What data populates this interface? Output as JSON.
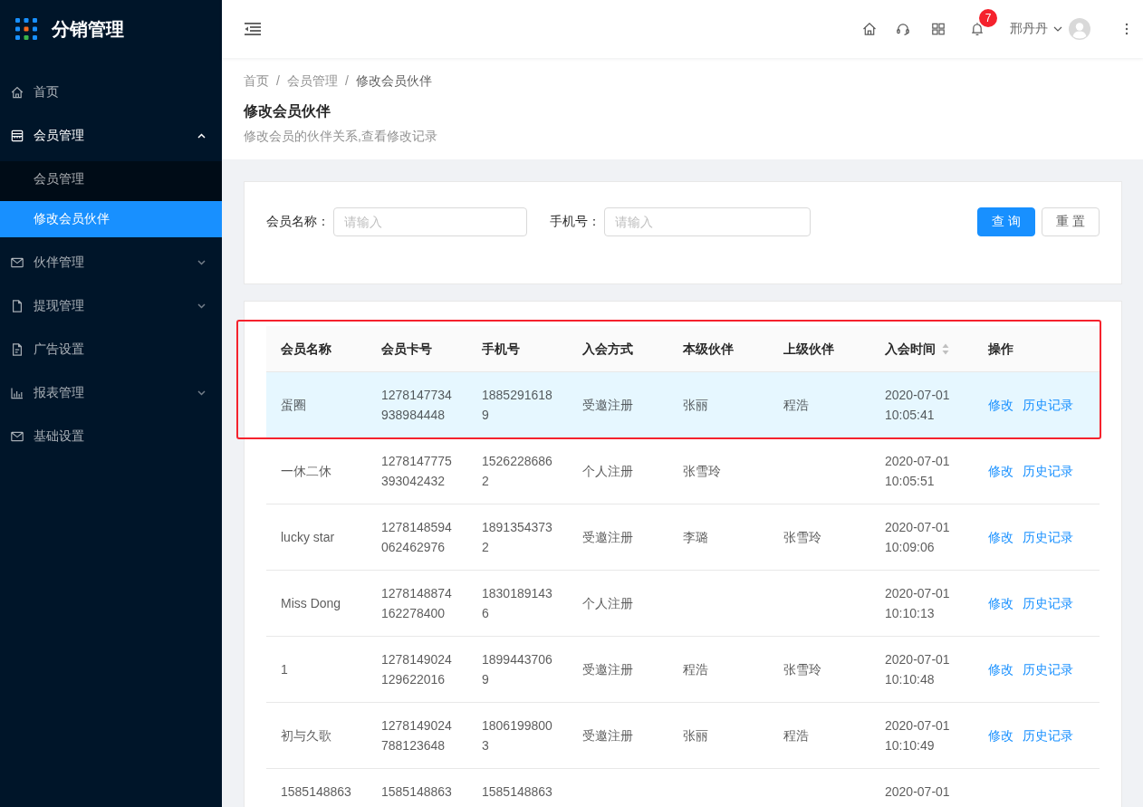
{
  "sidebar": {
    "title": "分销管理",
    "items": [
      {
        "kind": "link",
        "label": "首页",
        "selected": false
      },
      {
        "kind": "submenu",
        "label": "会员管理",
        "expanded": true,
        "children": [
          {
            "label": "会员管理",
            "selected": false
          },
          {
            "label": "修改会员伙伴",
            "selected": true
          }
        ]
      },
      {
        "kind": "submenu",
        "label": "伙伴管理",
        "expanded": false
      },
      {
        "kind": "submenu",
        "label": "提现管理",
        "expanded": false
      },
      {
        "kind": "link",
        "label": "广告设置",
        "selected": false
      },
      {
        "kind": "submenu",
        "label": "报表管理",
        "expanded": false
      },
      {
        "kind": "link",
        "label": "基础设置",
        "selected": false
      }
    ]
  },
  "header": {
    "notification_count": "7",
    "user_name": "邢丹丹"
  },
  "page_header": {
    "breadcrumb": {
      "separator": "/",
      "items": [
        "首页",
        "会员管理",
        "修改会员伙伴"
      ]
    },
    "title": "修改会员伙伴",
    "description": "修改会员的伙伴关系,查看修改记录"
  },
  "search": {
    "fields": [
      {
        "label": "会员名称：",
        "placeholder": "请输入"
      },
      {
        "label": "手机号：",
        "placeholder": "请输入"
      }
    ],
    "buttons": [
      {
        "kind": "primary",
        "label": "查 询"
      },
      {
        "kind": "default",
        "label": "重 置"
      }
    ]
  },
  "table": {
    "header_framed": true,
    "columns": [
      {
        "label": "会员名称",
        "sortable": false
      },
      {
        "label": "会员卡号",
        "sortable": false
      },
      {
        "label": "手机号",
        "sortable": false
      },
      {
        "label": "入会方式",
        "sortable": false
      },
      {
        "label": "本级伙伴",
        "sortable": false
      },
      {
        "label": "上级伙伴",
        "sortable": false
      },
      {
        "label": "入会时间",
        "sortable": true
      },
      {
        "label": "操作",
        "sortable": false
      }
    ],
    "rows": [
      {
        "member_name": "蛋圈",
        "card_no": "1278147734938984448",
        "phone": "18852916189",
        "join_method": "受邀注册",
        "partner": "张丽",
        "upper_partner": "程浩",
        "join_time": "2020-07-01 10:05:41",
        "actions": [
          "修改",
          "历史记录"
        ],
        "highlighted": true,
        "framed": true
      },
      {
        "member_name": "一休二休",
        "card_no": "1278147775393042432",
        "phone": "15262286862",
        "join_method": "个人注册",
        "partner": "张雪玲",
        "join_time": "2020-07-01 10:05:51",
        "actions": [
          "修改",
          "历史记录"
        ],
        "highlighted": false,
        "framed": false
      },
      {
        "member_name": "lucky star",
        "card_no": "1278148594062462976",
        "phone": "18913543732",
        "join_method": "受邀注册",
        "partner": "李璐",
        "upper_partner": "张雪玲",
        "join_time": "2020-07-01 10:09:06",
        "actions": [
          "修改",
          "历史记录"
        ],
        "highlighted": false,
        "framed": false
      },
      {
        "member_name": "Miss Dong",
        "card_no": "1278148874162278400",
        "phone": "18301891436",
        "join_method": "个人注册",
        "join_time": "2020-07-01 10:10:13",
        "actions": [
          "修改",
          "历史记录"
        ],
        "highlighted": false,
        "framed": false
      },
      {
        "member_name": "1",
        "card_no": "1278149024129622016",
        "phone": "18994437069",
        "join_method": "受邀注册",
        "partner": "程浩",
        "upper_partner": "张雪玲",
        "join_time": "2020-07-01 10:10:48",
        "actions": [
          "修改",
          "历史记录"
        ],
        "highlighted": false,
        "framed": false
      },
      {
        "member_name": "初与久歌",
        "card_no": "1278149024788123648",
        "phone": "18061998003",
        "join_method": "受邀注册",
        "partner": "张丽",
        "upper_partner": "程浩",
        "join_time": "2020-07-01 10:10:49",
        "actions": [
          "修改",
          "历史记录"
        ],
        "highlighted": false,
        "framed": false
      },
      {
        "member_name": "1585148863",
        "card_no": "1585148863",
        "phone": "1585148863",
        "join_time": "2020-07-01",
        "highlighted": false,
        "framed": false
      }
    ]
  }
}
